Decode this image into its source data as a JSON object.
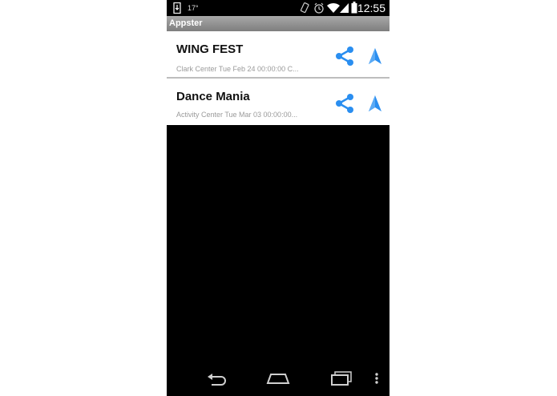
{
  "status_bar": {
    "temperature": "17°",
    "time": "12:55"
  },
  "app": {
    "title": "Appster"
  },
  "events": [
    {
      "title": "WING FEST",
      "subtitle": "Clark Center Tue Feb 24 00:00:00 C..."
    },
    {
      "title": "Dance Mania",
      "subtitle": "Activity Center Tue Mar 03 00:00:00..."
    }
  ],
  "icons": {
    "status_left": "download-notification-icon",
    "share": "share-icon",
    "navigate": "navigation-arrow-icon",
    "back": "back-icon",
    "home": "home-icon",
    "recents": "recent-apps-icon",
    "menu": "overflow-menu-icon"
  },
  "colors": {
    "accent": "#2a8ef0",
    "titlebar": "#8e8e8e"
  }
}
